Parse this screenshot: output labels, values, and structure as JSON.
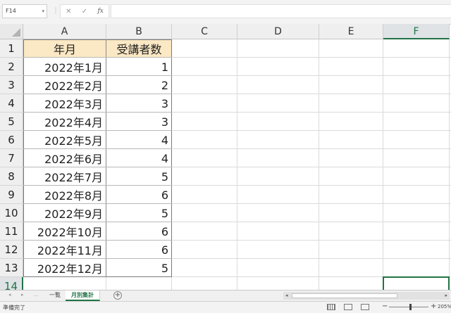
{
  "formula_bar": {
    "name_box": "F14",
    "name_box_dropdown": "▾",
    "separator": "⋮",
    "cancel": "✕",
    "enter": "✓",
    "fx": "fx",
    "content": ""
  },
  "columns": [
    "A",
    "B",
    "C",
    "D",
    "E",
    "F"
  ],
  "rows": [
    "1",
    "2",
    "3",
    "4",
    "5",
    "6",
    "7",
    "8",
    "9",
    "10",
    "11",
    "12",
    "13",
    "14"
  ],
  "table": {
    "headers": [
      "年月",
      "受講者数"
    ],
    "months": [
      "2022年1月",
      "2022年2月",
      "2022年3月",
      "2022年4月",
      "2022年5月",
      "2022年6月",
      "2022年7月",
      "2022年8月",
      "2022年9月",
      "2022年10月",
      "2022年11月",
      "2022年12月"
    ],
    "counts": [
      "1",
      "2",
      "3",
      "3",
      "4",
      "4",
      "5",
      "6",
      "5",
      "6",
      "6",
      "5"
    ]
  },
  "selection": {
    "cell": "F14",
    "column": "F",
    "row": "14"
  },
  "sheet_tabs": {
    "nav_prev": "◂",
    "nav_next": "▸",
    "ellipsis": "…",
    "tabs": [
      "一覧",
      "月別集計"
    ],
    "active": "月別集計",
    "add": "+"
  },
  "status_bar": {
    "status": "準備完了",
    "zoom_minus": "−",
    "zoom_plus": "+",
    "zoom": "205%"
  },
  "colors": {
    "accent": "#217346",
    "header_fill": "#fbe8c4",
    "gridline": "#dadada"
  }
}
